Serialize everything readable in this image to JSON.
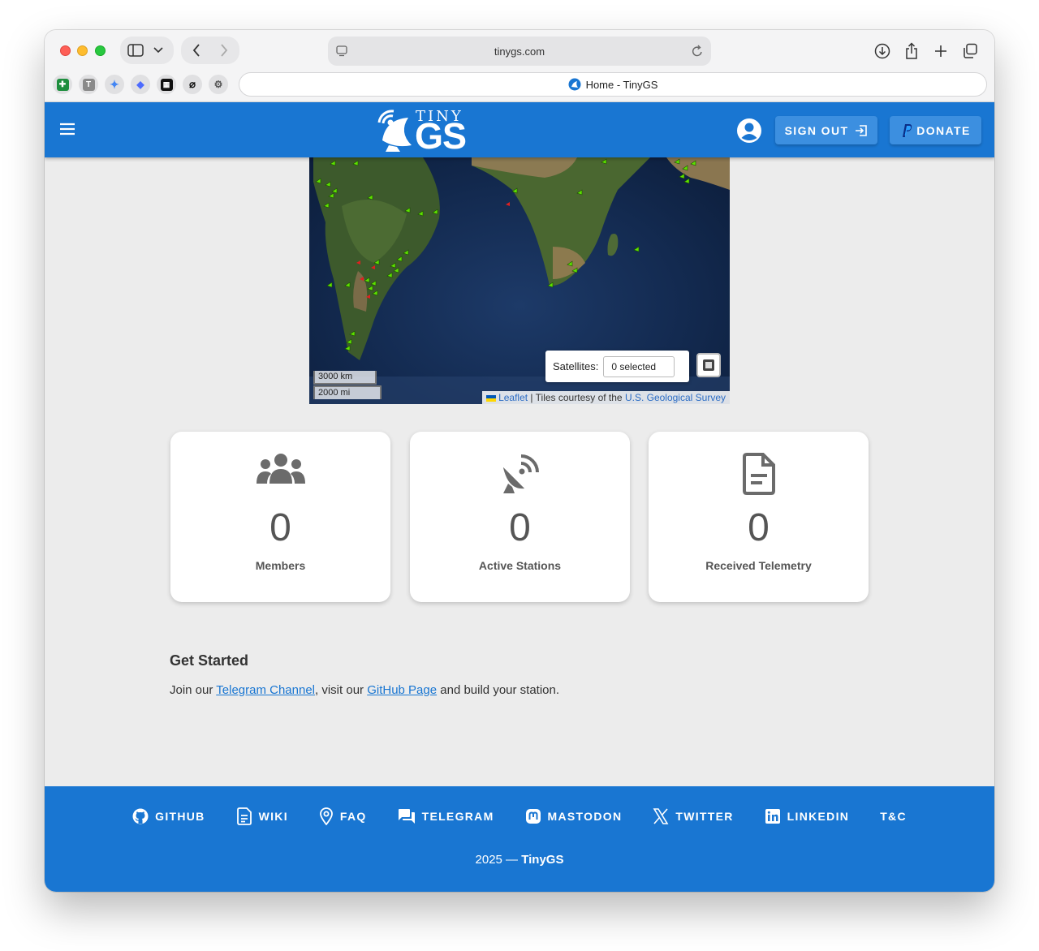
{
  "browser": {
    "url": "tinygs.com",
    "tab_title": "Home - TinyGS"
  },
  "header": {
    "logo_tiny": "TINY",
    "logo_gs": "GS",
    "signout_label": "SIGN OUT",
    "donate_label": "DONATE"
  },
  "map": {
    "satellites_label": "Satellites:",
    "satellites_select_value": "0 selected",
    "scale_km": "3000 km",
    "scale_mi": "2000 mi",
    "attribution_leaflet": "Leaflet",
    "attribution_text": " | Tiles courtesy of the ",
    "attribution_usgs": "U.S. Geological Survey"
  },
  "stats": [
    {
      "icon": "members-icon",
      "value": "0",
      "label": "Members"
    },
    {
      "icon": "satellite-dish-icon",
      "value": "0",
      "label": "Active Stations"
    },
    {
      "icon": "document-icon",
      "value": "0",
      "label": "Received Telemetry"
    }
  ],
  "get_started": {
    "title": "Get Started",
    "text_before": "Join our ",
    "telegram_link": "Telegram Channel",
    "text_middle": ", visit our ",
    "github_link": "GitHub Page",
    "text_after": " and build your station."
  },
  "footer": {
    "links": [
      "GITHUB",
      "WIKI",
      "FAQ",
      "TELEGRAM",
      "MASTODON",
      "TWITTER",
      "LINKEDIN",
      "T&C"
    ],
    "copyright_year": "2025 — ",
    "copyright_name": "TinyGS"
  },
  "colors": {
    "primary": "#1976d2",
    "button": "#3c8fe0",
    "background": "#ececec",
    "station_marker": "#5ee000",
    "satellite_marker": "#e02020"
  }
}
